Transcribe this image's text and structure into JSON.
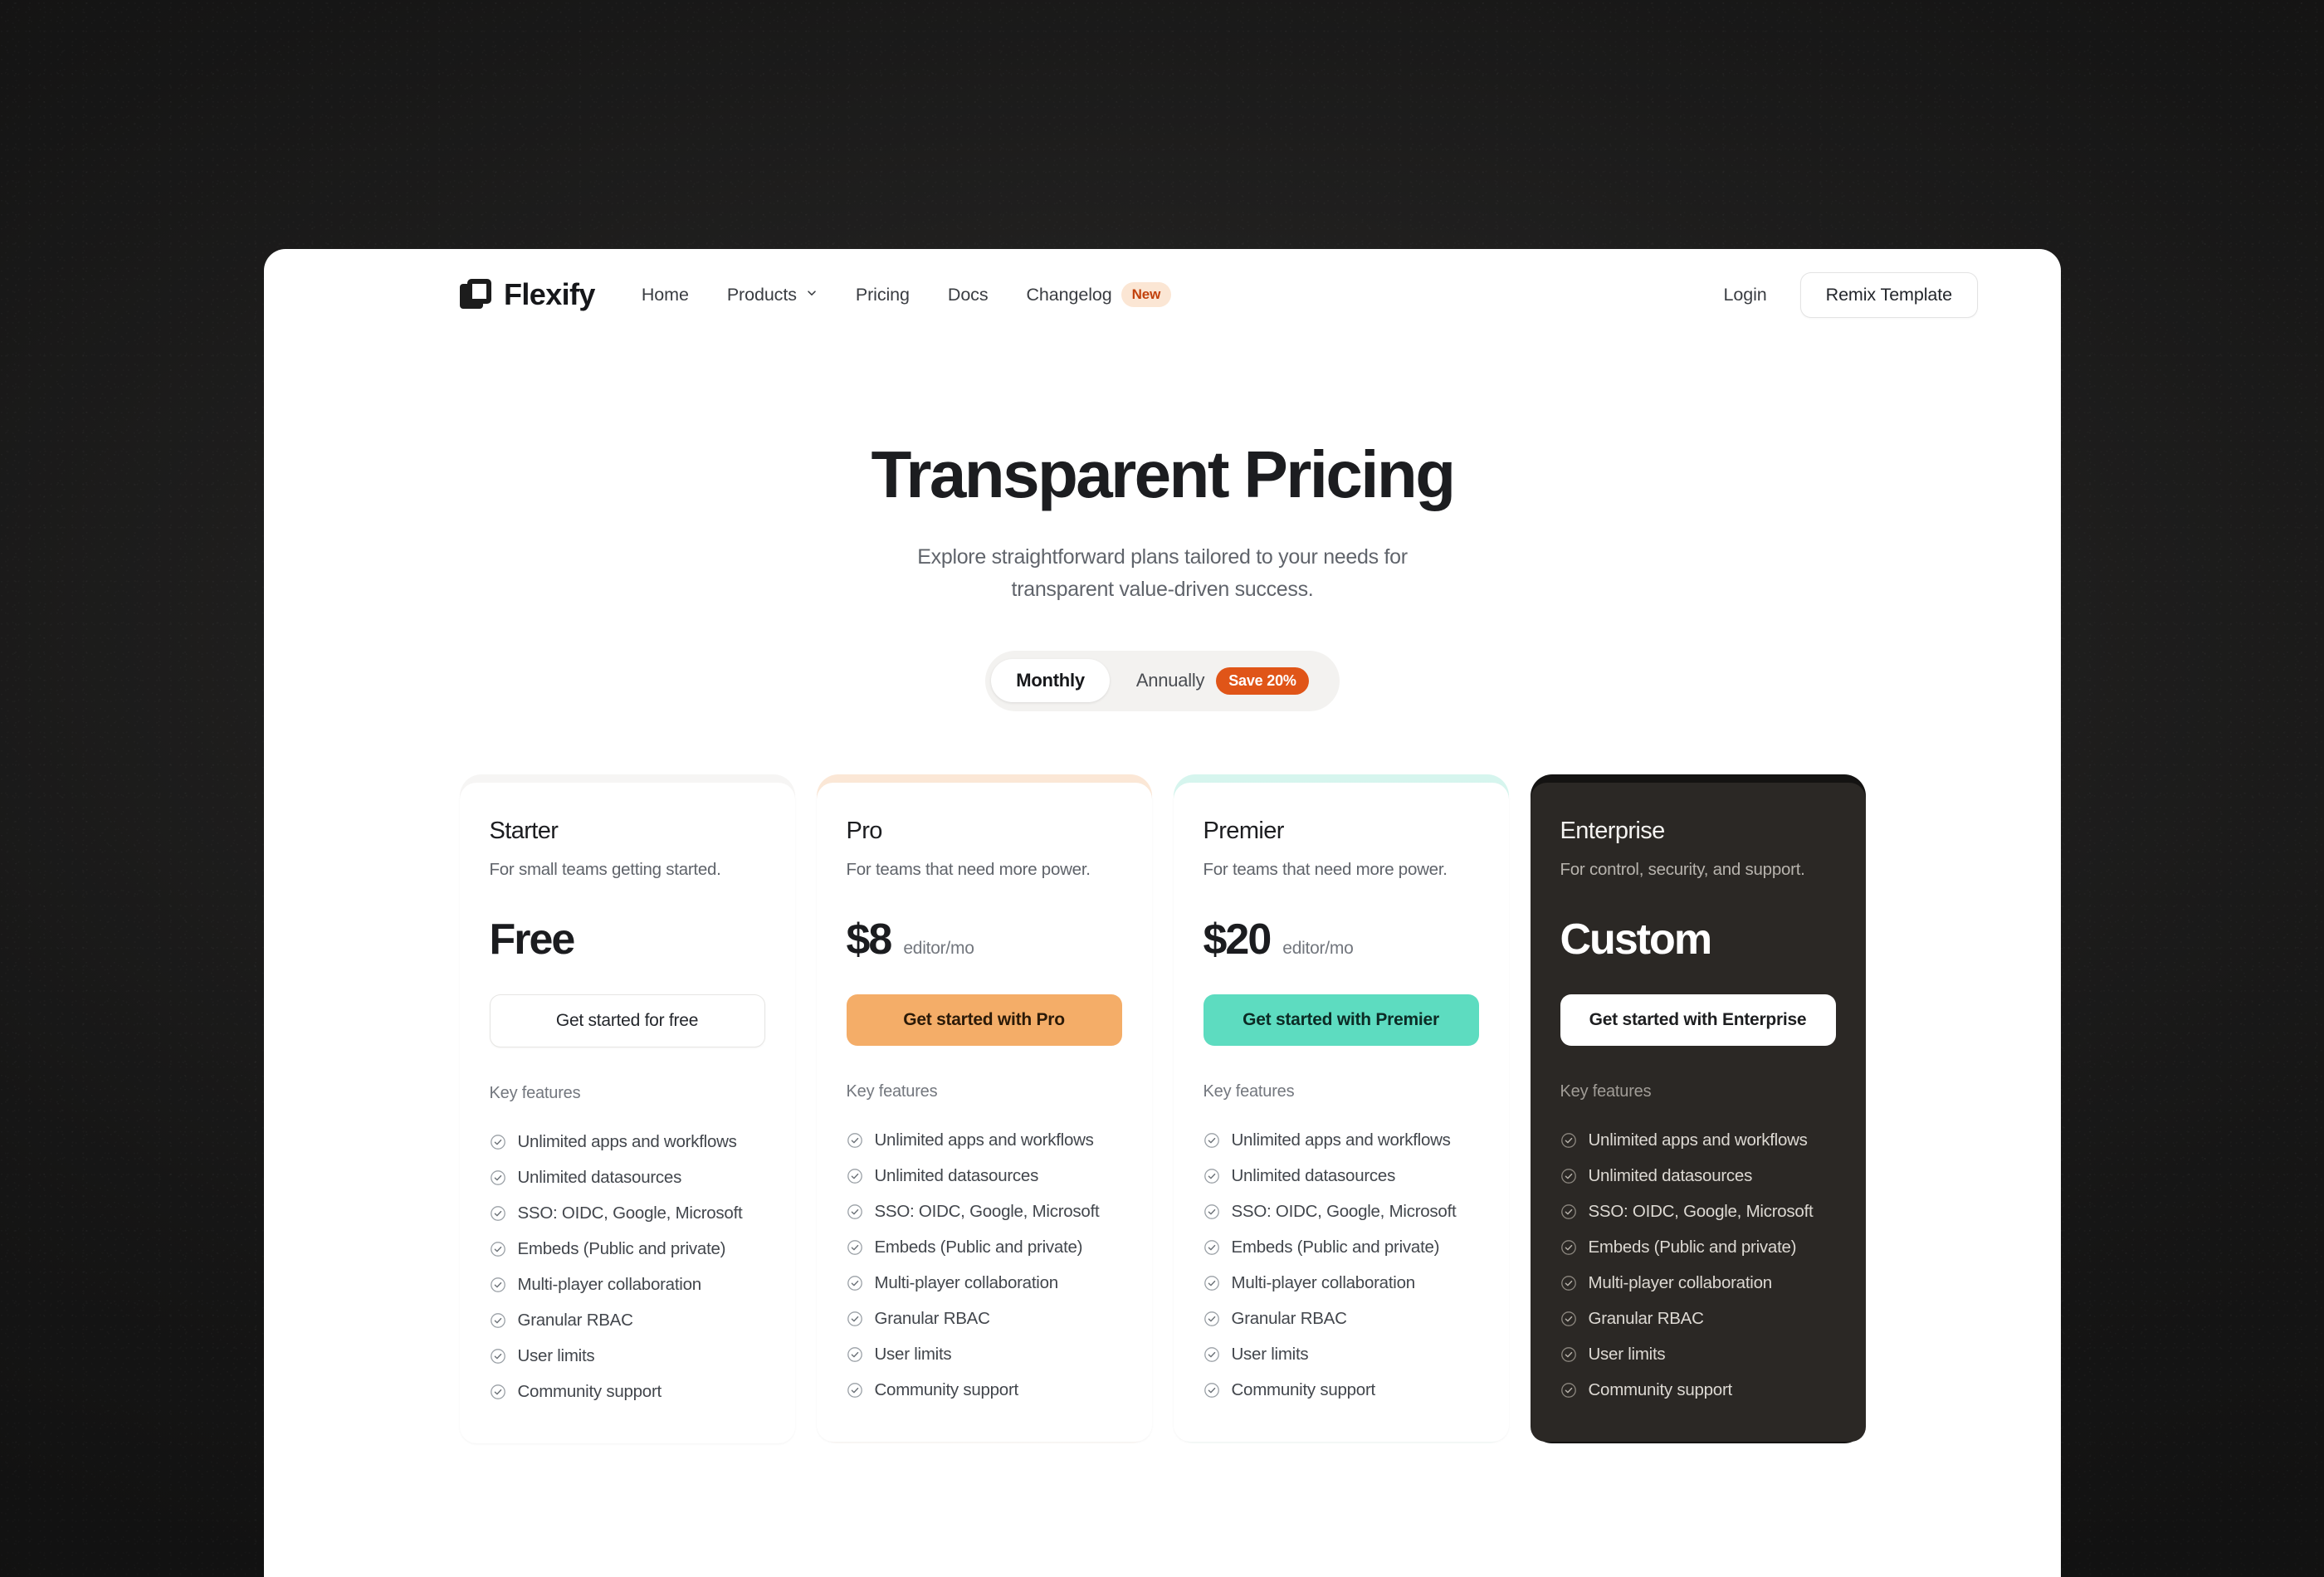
{
  "nav": {
    "brand": "Flexify",
    "links": [
      {
        "label": "Home",
        "has_chevron": false,
        "badge": null
      },
      {
        "label": "Products",
        "has_chevron": true,
        "badge": null
      },
      {
        "label": "Pricing",
        "has_chevron": false,
        "badge": null
      },
      {
        "label": "Docs",
        "has_chevron": false,
        "badge": null
      },
      {
        "label": "Changelog",
        "has_chevron": false,
        "badge": "New"
      }
    ],
    "login_label": "Login",
    "remix_label": "Remix Template"
  },
  "hero": {
    "title": "Transparent Pricing",
    "subtitle_line1": "Explore straightforward plans tailored to your needs for",
    "subtitle_line2": "transparent value-driven success."
  },
  "billing_toggle": {
    "monthly_label": "Monthly",
    "annually_label": "Annually",
    "save_badge": "Save 20%",
    "selected": "Monthly"
  },
  "features_label": "Key features",
  "plans": [
    {
      "name": "Starter",
      "description": "For small teams getting started.",
      "price": "Free",
      "price_unit": "",
      "cta": "Get started for free",
      "features": [
        "Unlimited apps and workflows",
        "Unlimited datasources",
        "SSO: OIDC, Google, Microsoft",
        "Embeds (Public and private)",
        "Multi-player collaboration",
        "Granular RBAC",
        "User limits",
        "Community support"
      ]
    },
    {
      "name": "Pro",
      "description": "For teams that need more power.",
      "price": "$8",
      "price_unit": "editor/mo",
      "cta": "Get started with Pro",
      "features": [
        "Unlimited apps and workflows",
        "Unlimited datasources",
        "SSO: OIDC, Google, Microsoft",
        "Embeds (Public and private)",
        "Multi-player collaboration",
        "Granular RBAC",
        "User limits",
        "Community support"
      ]
    },
    {
      "name": "Premier",
      "description": "For teams that need more power.",
      "price": "$20",
      "price_unit": "editor/mo",
      "cta": "Get started with Premier",
      "features": [
        "Unlimited apps and workflows",
        "Unlimited datasources",
        "SSO: OIDC, Google, Microsoft",
        "Embeds (Public and private)",
        "Multi-player collaboration",
        "Granular RBAC",
        "User limits",
        "Community support"
      ]
    },
    {
      "name": "Enterprise",
      "description": "For control, security, and support.",
      "price": "Custom",
      "price_unit": "",
      "cta": "Get started with Enterprise",
      "features": [
        "Unlimited apps and workflows",
        "Unlimited datasources",
        "SSO: OIDC, Google, Microsoft",
        "Embeds (Public and private)",
        "Multi-player collaboration",
        "Granular RBAC",
        "User limits",
        "Community support"
      ]
    }
  ],
  "colors": {
    "accent_orange": "#e05518",
    "badge_new_bg": "#fbe6d4",
    "badge_new_text": "#c2410c",
    "pro_button": "#f4ad68",
    "premier_button": "#5ddcc0",
    "enterprise_card": "#2b2825",
    "page_background": "#161616"
  }
}
